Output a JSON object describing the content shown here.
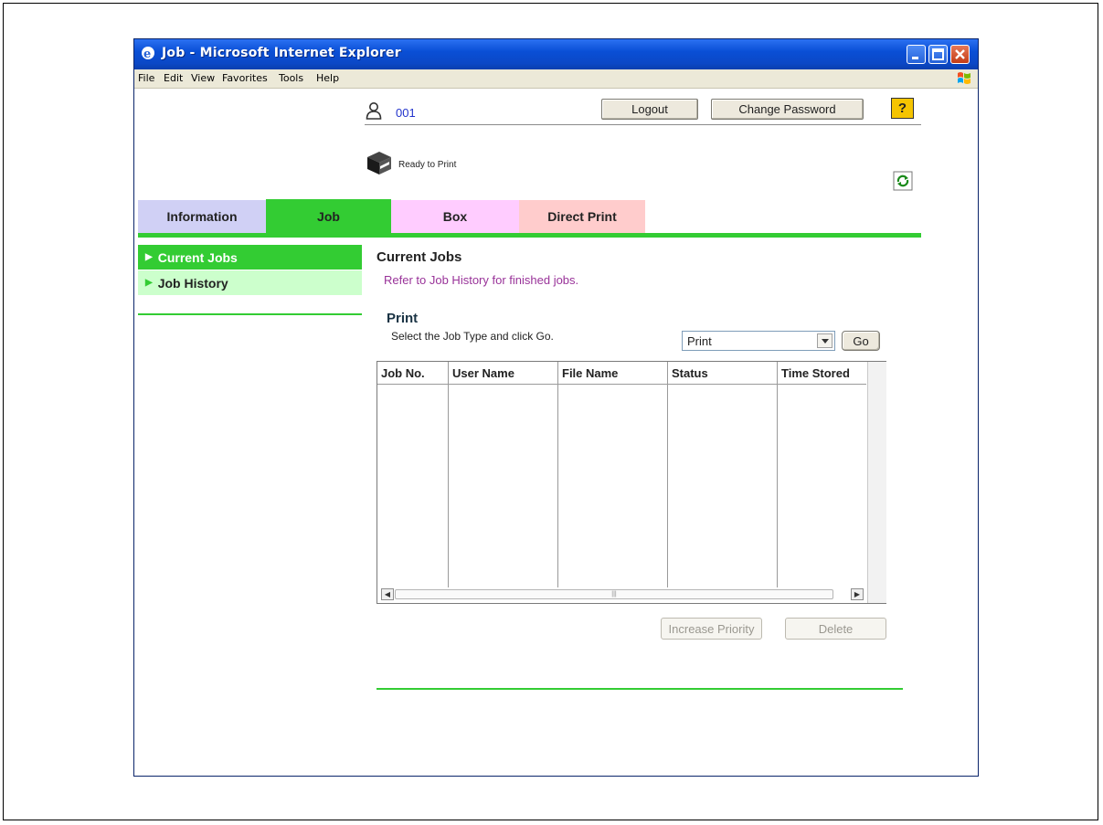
{
  "window": {
    "title": "Job - Microsoft Internet Explorer"
  },
  "menu": [
    "File",
    "Edit",
    "View",
    "Favorites",
    "Tools",
    "Help"
  ],
  "header": {
    "user_id": "001",
    "logout_label": "Logout",
    "change_password_label": "Change Password",
    "help_label": "?",
    "status_text": "Ready to Print"
  },
  "tabs": [
    {
      "label": "Information",
      "color": "#d0d0f5"
    },
    {
      "label": "Job",
      "color": "#33cc33"
    },
    {
      "label": "Box",
      "color": "#ffccff"
    },
    {
      "label": "Direct Print",
      "color": "#ffcccc"
    }
  ],
  "sidebar": {
    "items": [
      {
        "label": "Current Jobs",
        "active": true
      },
      {
        "label": "Job History",
        "active": false
      }
    ]
  },
  "main": {
    "heading": "Current Jobs",
    "note": "Refer to Job History for finished jobs.",
    "section_title": "Print",
    "instruction": "Select the Job Type and click Go.",
    "job_type_value": "Print",
    "go_label": "Go",
    "table": {
      "columns": [
        "Job No.",
        "User Name",
        "File Name",
        "Status",
        "Time Stored"
      ],
      "rows": []
    },
    "increase_priority_label": "Increase Priority",
    "delete_label": "Delete"
  },
  "colors": {
    "accent_green": "#33cc33",
    "sidebar_inactive": "#ccffcc",
    "note_text": "#993399",
    "title_blue": "#0a4fd6"
  },
  "icons": [
    "ie-icon",
    "minimize-icon",
    "maximize-icon",
    "close-icon",
    "windows-logo-icon",
    "user-icon",
    "printer-icon",
    "refresh-icon",
    "help-icon",
    "dropdown-arrow-icon",
    "scroll-left-icon",
    "scroll-right-icon"
  ]
}
